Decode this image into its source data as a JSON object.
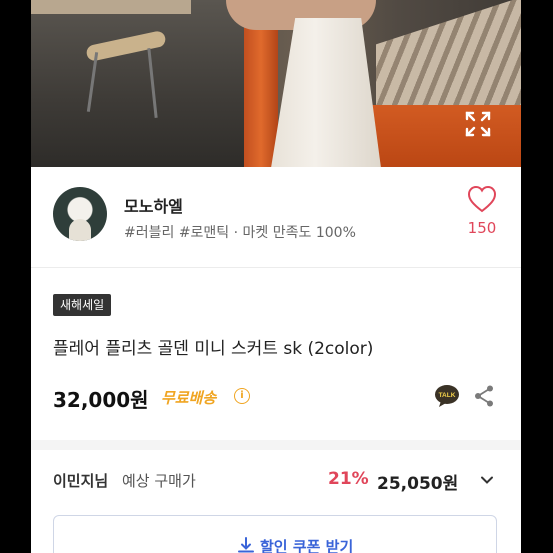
{
  "product_image": {
    "alt": "product photo",
    "expand_icon": "expand-icon"
  },
  "seller": {
    "name": "모노하엘",
    "tags": "#러블리 #로맨틱 · 마켓 만족도 100%",
    "like_count": "150",
    "like_icon": "heart-icon"
  },
  "product": {
    "badge": "새해세일",
    "title": "플레어 플리츠 골덴 미니 스커트 sk (2color)",
    "price": "32,000원",
    "shipping": "무료배송",
    "shipping_info_icon": "info-icon",
    "talk_icon_label": "TALK"
  },
  "member_price": {
    "name": "이민지님",
    "label": "예상 구매가",
    "discount": "21%",
    "price": "25,050원"
  },
  "coupon": {
    "label": "할인 쿠폰 받기"
  },
  "colors": {
    "accent_pink": "#e0465a",
    "shipping_yellow": "#f0a522",
    "coupon_blue": "#3a64d8"
  }
}
